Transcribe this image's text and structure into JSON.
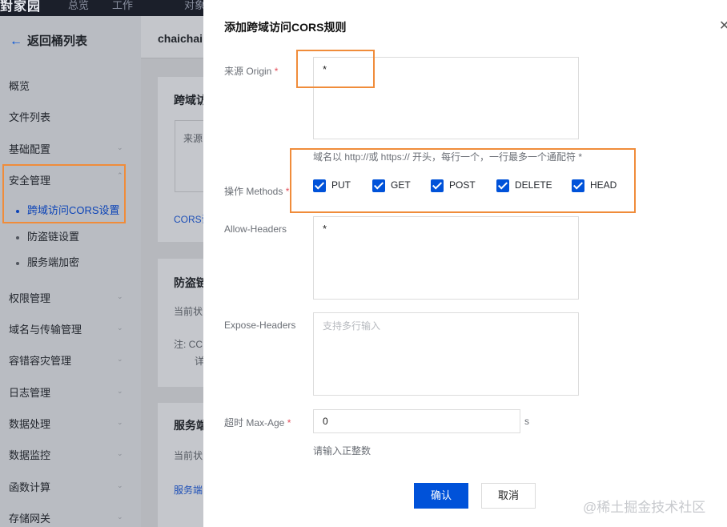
{
  "topbar": {
    "brand": "對家园",
    "tabs": [
      "总览",
      "工作",
      "对象"
    ]
  },
  "sidebar": {
    "back_label": "返回桶列表",
    "items_top": [
      "概览",
      "文件列表",
      "基础配置",
      "安全管理"
    ],
    "sub_items": [
      "跨域访问CORS设置",
      "防盗链设置",
      "服务端加密"
    ],
    "items_bottom": [
      "权限管理",
      "域名与传输管理",
      "容错容灾管理",
      "日志管理",
      "数据处理",
      "数据监控",
      "函数计算",
      "存储网关"
    ]
  },
  "bucket": {
    "name": "chaichai"
  },
  "cards": {
    "cors_title": "跨域访",
    "cors_table_header": "来源",
    "cors_link": "CORS设",
    "hotlink_title": "防盗链",
    "hotlink_status": "当前状",
    "hotlink_note": "注: CC",
    "hotlink_note2": "详",
    "sse_title": "服务端",
    "sse_status": "当前状",
    "sse_link": "服务端"
  },
  "modal": {
    "title": "添加跨域访问CORS规则",
    "close_icon": "close-icon",
    "origin": {
      "label": "来源 Origin",
      "required_mark": "*",
      "value": "*",
      "hint": "域名以 http://或 https:// 开头，每行一个，一行最多一个通配符 *"
    },
    "methods": {
      "label": "操作 Methods",
      "required_mark": "*",
      "options": [
        "PUT",
        "GET",
        "POST",
        "DELETE",
        "HEAD"
      ],
      "checked": [
        true,
        true,
        true,
        true,
        true
      ]
    },
    "allow_headers": {
      "label": "Allow-Headers",
      "value": "*"
    },
    "expose_headers": {
      "label": "Expose-Headers",
      "placeholder": "支持多行输入"
    },
    "max_age": {
      "label": "超时 Max-Age",
      "required_mark": "*",
      "value": "0",
      "unit": "s",
      "hint": "请输入正整数"
    },
    "confirm_label": "确认",
    "cancel_label": "取消"
  },
  "watermark": "@稀土掘金技术社区",
  "colors": {
    "primary": "#0052d9",
    "highlight": "#f08c3a",
    "required": "#e34d59"
  }
}
